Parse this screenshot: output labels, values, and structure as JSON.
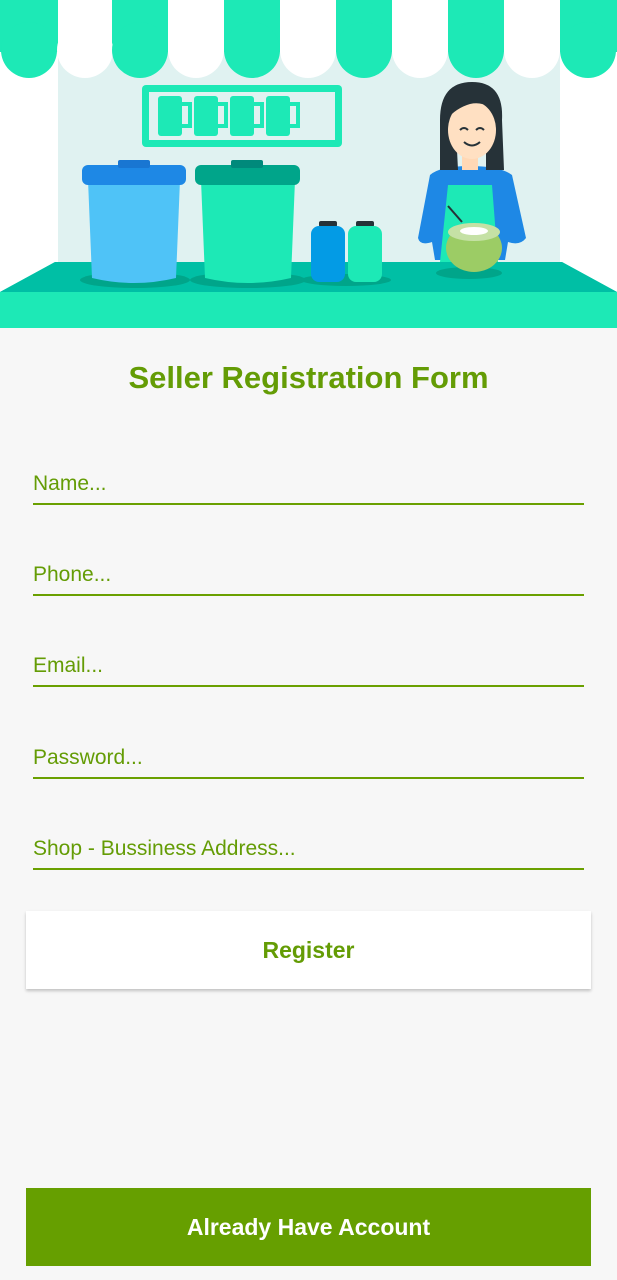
{
  "form": {
    "title": "Seller Registration Form",
    "fields": {
      "name_placeholder": "Name...",
      "phone_placeholder": "Phone...",
      "email_placeholder": "Email...",
      "password_placeholder": "Password...",
      "address_placeholder": "Shop - Bussiness Address..."
    },
    "register_label": "Register",
    "already_account_label": "Already Have Account"
  },
  "colors": {
    "accent_green": "#649c05",
    "button_green": "#669f00",
    "awning_teal": "#1de9b6"
  },
  "icons": {
    "banner": "seller-stall-illustration"
  }
}
